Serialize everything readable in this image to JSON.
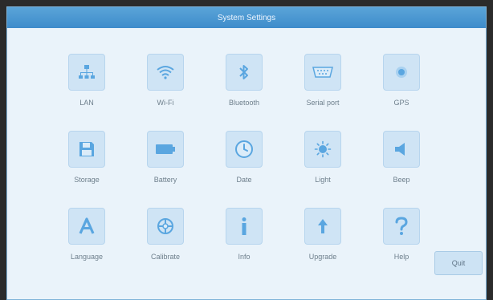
{
  "window": {
    "title": "System Settings"
  },
  "items": [
    {
      "label": "LAN",
      "icon": "network-icon"
    },
    {
      "label": "Wi-Fi",
      "icon": "wifi-icon"
    },
    {
      "label": "Bluetooth",
      "icon": "bluetooth-icon"
    },
    {
      "label": "Serial port",
      "icon": "serial-port-icon"
    },
    {
      "label": "GPS",
      "icon": "gps-icon"
    },
    {
      "label": "Storage",
      "icon": "floppy-disk-icon"
    },
    {
      "label": "Battery",
      "icon": "battery-icon"
    },
    {
      "label": "Date",
      "icon": "clock-icon"
    },
    {
      "label": "Light",
      "icon": "brightness-icon"
    },
    {
      "label": "Beep",
      "icon": "speaker-icon"
    },
    {
      "label": "Language",
      "icon": "letter-a-icon"
    },
    {
      "label": "Calibrate",
      "icon": "calibrate-icon"
    },
    {
      "label": "Info",
      "icon": "info-icon"
    },
    {
      "label": "Upgrade",
      "icon": "upgrade-arrow-icon"
    },
    {
      "label": "Help",
      "icon": "question-mark-icon"
    }
  ],
  "quit_label": "Quit",
  "colors": {
    "titlebar": "#4a97d2",
    "background": "#eaf3fa",
    "tile": "#cfe4f5",
    "icon": "#5aa6e0"
  }
}
